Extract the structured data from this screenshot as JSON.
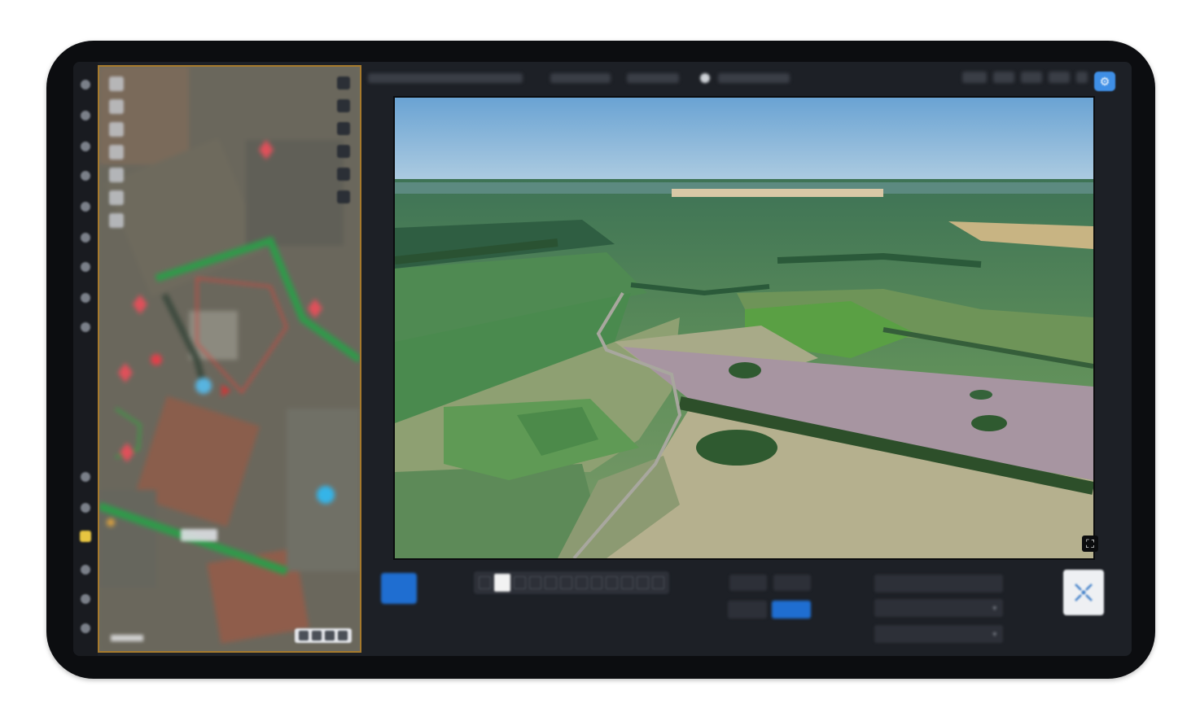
{
  "left_rail": {
    "icons": [
      "layers-icon",
      "target-icon",
      "route-icon",
      "camera-icon",
      "chat-icon",
      "marker-icon",
      "grid-icon",
      "settings-icon",
      "users-icon",
      "user-icon",
      "compass-icon",
      "note-icon",
      "edit-icon",
      "list-icon",
      "logout-icon"
    ],
    "active_icon": "note-icon"
  },
  "map": {
    "tools_left": [
      "cursor-tool",
      "draw-tool",
      "polygon-tool",
      "circle-tool",
      "ruler-tool",
      "eraser-tool",
      "text-tool"
    ],
    "tools_right": [
      "layers-tool",
      "zoom-in-tool",
      "zoom-out-tool",
      "locate-tool",
      "filter-tool",
      "gear-tool"
    ]
  },
  "colors": {
    "accent": "#3f8fe6",
    "primary_button": "#1f6ed1",
    "map_border": "#a67a2d",
    "route_green": "#2f9a4a",
    "marker_red": "#e0505a",
    "marker_cyan": "#35b4e8"
  }
}
